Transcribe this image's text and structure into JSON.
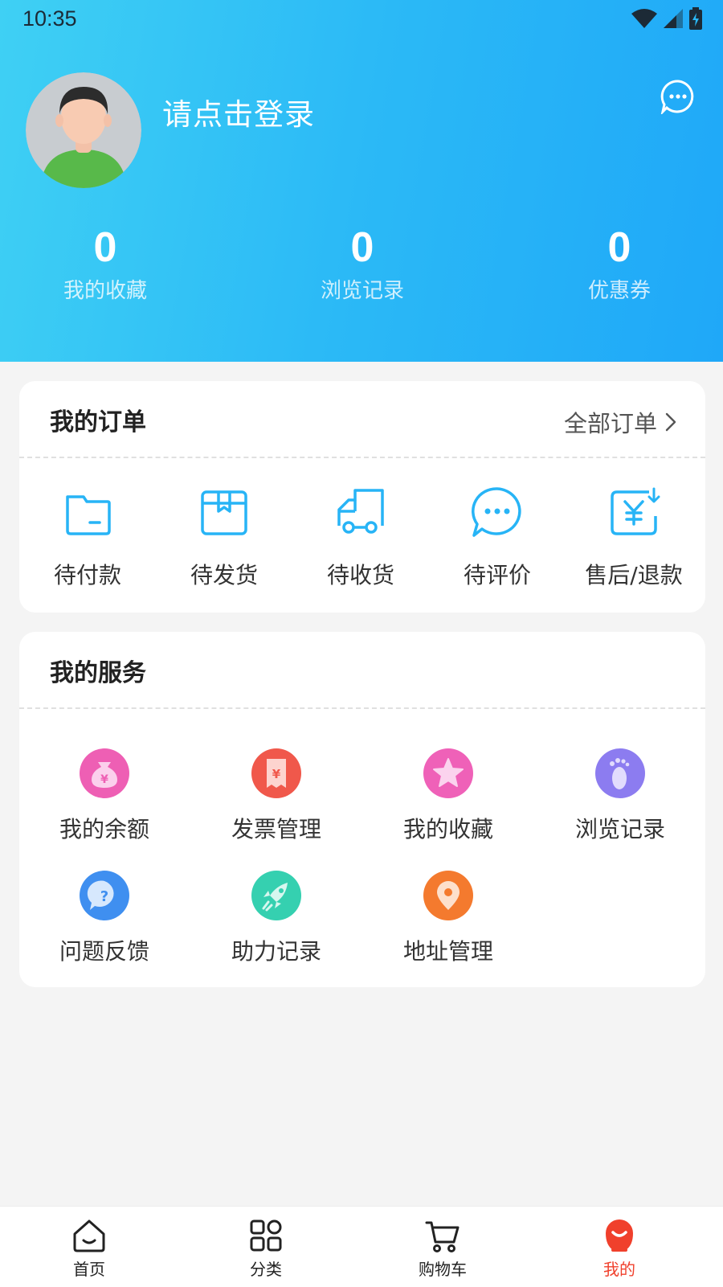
{
  "status_bar": {
    "time": "10:35"
  },
  "profile": {
    "login_prompt": "请点击登录",
    "avatar_icon": "user-avatar-icon",
    "message_icon": "chat-bubble-icon"
  },
  "stats": [
    {
      "value": "0",
      "label": "我的收藏"
    },
    {
      "value": "0",
      "label": "浏览记录"
    },
    {
      "value": "0",
      "label": "优惠券"
    }
  ],
  "orders": {
    "title": "我的订单",
    "all_link": "全部订单",
    "items": [
      {
        "label": "待付款",
        "icon": "wallet-icon"
      },
      {
        "label": "待发货",
        "icon": "package-icon"
      },
      {
        "label": "待收货",
        "icon": "delivery-truck-icon"
      },
      {
        "label": "待评价",
        "icon": "comment-icon"
      },
      {
        "label": "售后/退款",
        "icon": "refund-icon"
      }
    ]
  },
  "services": {
    "title": "我的服务",
    "items": [
      {
        "label": "我的余额",
        "icon": "money-bag-icon",
        "color": "#ee5fb4"
      },
      {
        "label": "发票管理",
        "icon": "invoice-icon",
        "color": "#f0584b"
      },
      {
        "label": "我的收藏",
        "icon": "star-icon",
        "color": "#ef61b8"
      },
      {
        "label": "浏览记录",
        "icon": "footprint-icon",
        "color": "#8c7cf0"
      },
      {
        "label": "问题反馈",
        "icon": "question-icon",
        "color": "#3f8ff0"
      },
      {
        "label": "助力记录",
        "icon": "rocket-icon",
        "color": "#35d0b0"
      },
      {
        "label": "地址管理",
        "icon": "location-pin-icon",
        "color": "#f47a2e"
      }
    ]
  },
  "tabbar": {
    "items": [
      {
        "label": "首页",
        "icon": "home-icon"
      },
      {
        "label": "分类",
        "icon": "category-grid-icon"
      },
      {
        "label": "购物车",
        "icon": "shopping-cart-icon"
      },
      {
        "label": "我的",
        "icon": "profile-mascot-icon",
        "active": true
      }
    ]
  },
  "colors": {
    "accent": "#27b4f6",
    "active_tab": "#f0402c",
    "header_start": "#3fd0f4",
    "header_end": "#1fa8f8"
  }
}
